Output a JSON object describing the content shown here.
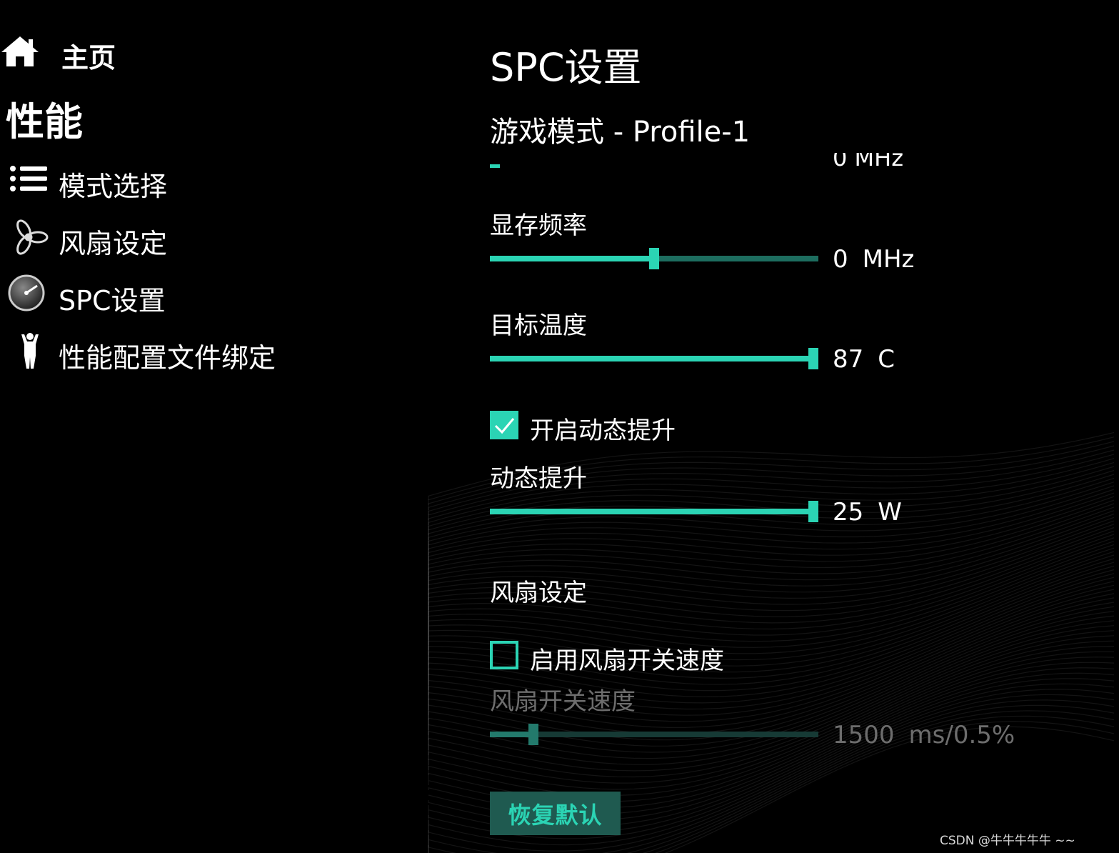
{
  "sidebar": {
    "home": {
      "label": "主页",
      "icon": "home-icon"
    },
    "section_title": "性能",
    "items": [
      {
        "label": "模式选择",
        "icon": "list-icon"
      },
      {
        "label": "风扇设定",
        "icon": "fan-icon"
      },
      {
        "label": "SPC设置",
        "icon": "gauge-icon"
      },
      {
        "label": "性能配置文件绑定",
        "icon": "person-icon"
      }
    ]
  },
  "main": {
    "title": "SPC设置",
    "profile": "游戏模式 - Profile-1",
    "clipped_row": {
      "value": "0 MHz"
    },
    "memory_clock": {
      "label": "显存频率",
      "value": "0",
      "unit": "MHz",
      "fill_fraction": 0.5
    },
    "target_temp": {
      "label": "目标温度",
      "value": "87",
      "unit": "C",
      "fill_fraction": 1.0
    },
    "dynamic_boost_toggle": {
      "label": "开启动态提升",
      "checked": true
    },
    "dynamic_boost": {
      "label": "动态提升",
      "value": "25",
      "unit": "W",
      "fill_fraction": 1.0
    },
    "fan_section_title": "风扇设定",
    "fan_switch_toggle": {
      "label": "启用风扇开关速度",
      "checked": false
    },
    "fan_switch_speed": {
      "label": "风扇开关速度",
      "value": "1500",
      "unit": "ms/0.5%",
      "fill_fraction": 0.12,
      "disabled": true
    },
    "restore_button": "恢复默认"
  },
  "watermark": "CSDN @牛牛牛牛牛 ~~",
  "colors": {
    "accent": "#2bd4b4",
    "background": "#000000",
    "disabled_text": "#6d6d6d"
  }
}
